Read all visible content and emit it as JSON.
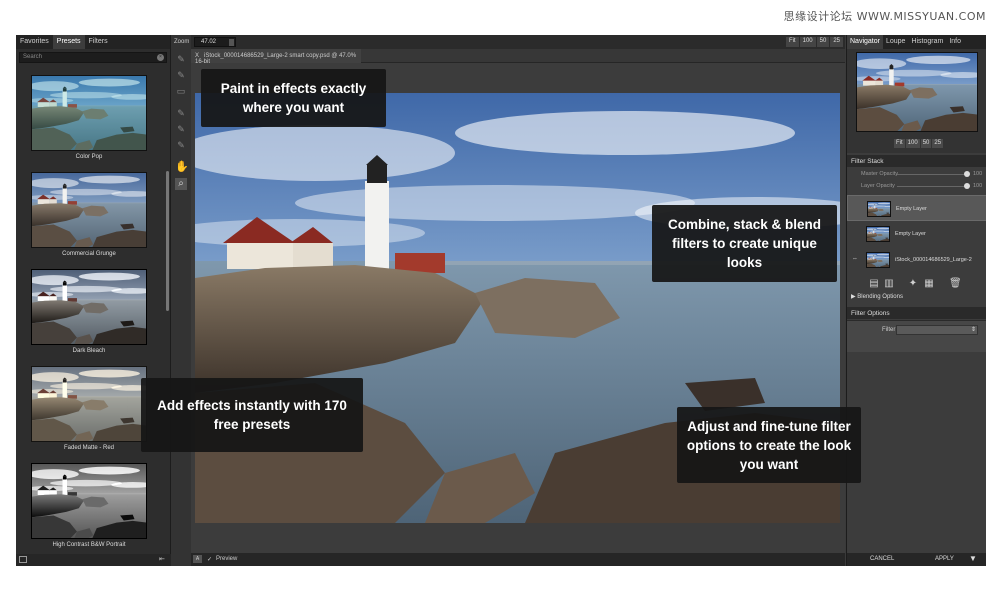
{
  "watermark": "思缘设计论坛 WWW.MISSYUAN.COM",
  "left_panel": {
    "tabs": [
      "Favorites",
      "Presets",
      "Filters"
    ],
    "search_placeholder": "Search",
    "presets": [
      {
        "label": "Color Pop"
      },
      {
        "label": "Commercial Grunge"
      },
      {
        "label": "Dark Bleach"
      },
      {
        "label": "Faded Matte - Red"
      },
      {
        "label": "High Contrast B&W Portrait"
      }
    ]
  },
  "toolbar": {
    "zoom_label": "Zoom",
    "zoom_value": "47.02",
    "zoom_buttons": [
      "Fit",
      "100",
      "50",
      "25"
    ],
    "tools": [
      "brush-icon",
      "brush-icon",
      "eraser-icon",
      "brush-icon",
      "brush-icon",
      "hand-icon",
      "zoom-icon"
    ]
  },
  "file_tab": {
    "close": "X",
    "title": "iStock_000014686529_Large-2 smart copy.psd @ 47.0% 16-bit"
  },
  "bottom_bar": {
    "preview_label": "Preview",
    "check": "✓",
    "cancel": "CANCEL",
    "apply": "APPLY"
  },
  "right_panel": {
    "tabs": [
      "Navigator",
      "Loupe",
      "Histogram",
      "Info"
    ],
    "nav_buttons": [
      "Fit",
      "100",
      "50",
      "25"
    ],
    "filter_stack_title": "Filter Stack",
    "master_opacity_label": "Master Opacity",
    "master_opacity_value": "100",
    "layer_opacity_label": "Layer Opacity",
    "layer_opacity_value": "100",
    "layers": [
      {
        "name": "Empty Layer",
        "selected": true
      },
      {
        "name": "Empty Layer",
        "selected": false
      },
      {
        "name": "iStock_000014686529_Large-2",
        "selected": false
      }
    ],
    "blending_options": "Blending Options",
    "filter_options_title": "Filter Options",
    "filter_label": "Filter"
  },
  "callouts": {
    "paint": "Paint in effects exactly where you want",
    "combine": "Combine, stack & blend filters to create unique looks",
    "add": "Add effects instantly with 170 free presets",
    "adjust": "Adjust and fine-tune filter options to create the look you want"
  }
}
